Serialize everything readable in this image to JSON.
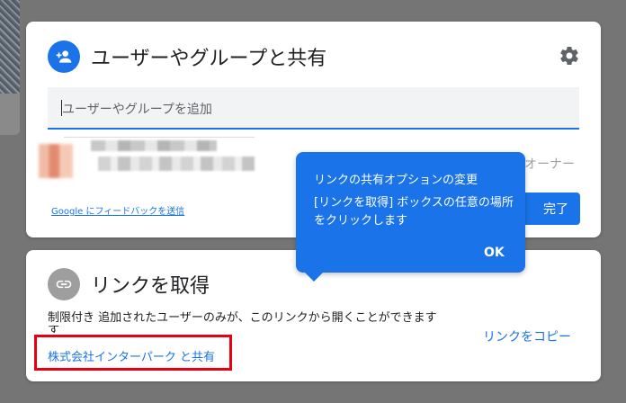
{
  "share_dialog": {
    "title": "ユーザーやグループと共有",
    "add_people_placeholder": "ユーザーやグループを追加",
    "owner_label": "オーナー",
    "feedback_link": "Google にフィードバックを送信",
    "done_label": "完了"
  },
  "link_dialog": {
    "title": "リンクを取得",
    "restriction_text": "制限付き 追加されたユーザーのみが、このリンクから開くことができます",
    "restriction_overflow": "す",
    "org_share_link": "株式会社インターパーク と共有",
    "copy_link": "リンクをコピー"
  },
  "tooltip": {
    "title": "リンクの共有オプションの変更",
    "body": "[リンクを取得] ボックスの任意の場所をクリックします",
    "ok_label": "OK"
  },
  "colors": {
    "accent": "#1a73e8",
    "highlight": "#e60012",
    "overlay": "#757575"
  },
  "icons": [
    "person-add-icon",
    "gear-icon",
    "link-icon"
  ]
}
